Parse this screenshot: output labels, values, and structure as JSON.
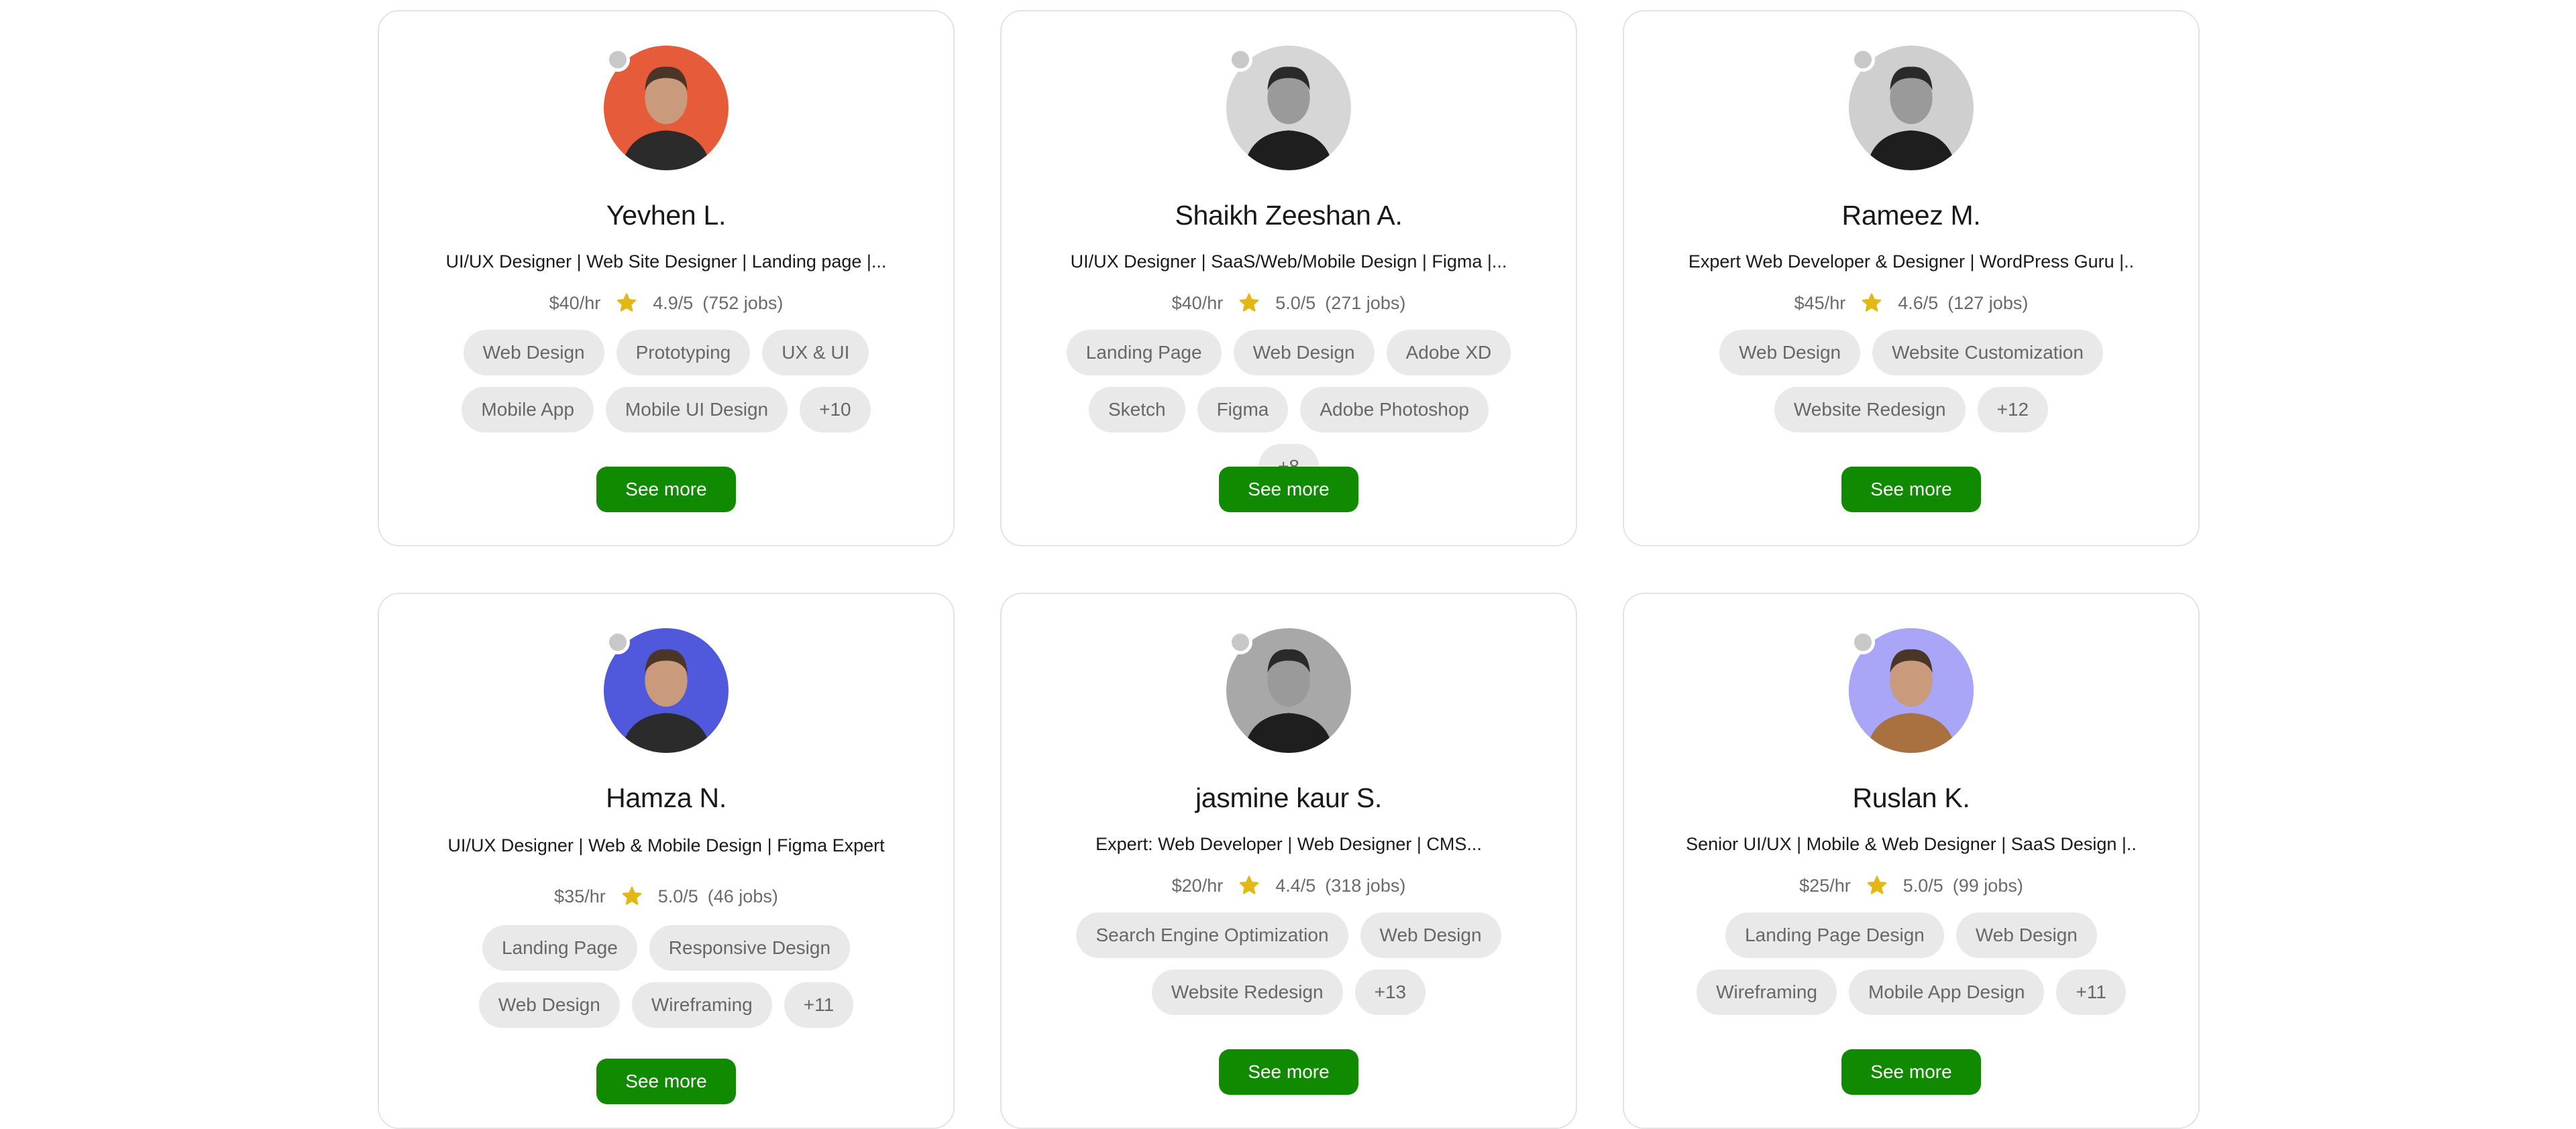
{
  "colors": {
    "accent_green": "#108a00",
    "chip_bg": "#e9e9e9",
    "star": "#e3b814",
    "status_offline": "#c8c8c8"
  },
  "cards": [
    {
      "name": "Yevhen L.",
      "headline": "UI/UX Designer | Web Site Designer | Landing page |...",
      "rate": "$40/hr",
      "rating": "4.9/5",
      "jobs": "(752 jobs)",
      "avatar_icon": "profile-photo",
      "avatar_bg": "#e65c3b",
      "skills": [
        "Web Design",
        "Prototyping",
        "UX & UI",
        "Mobile App",
        "Mobile UI Design",
        "+10"
      ],
      "button_label": "See more"
    },
    {
      "name": "Shaikh Zeeshan A.",
      "headline": "UI/UX Designer | SaaS/Web/Mobile Design | Figma |...",
      "rate": "$40/hr",
      "rating": "5.0/5",
      "jobs": "(271 jobs)",
      "avatar_icon": "profile-photo",
      "avatar_bg": "#d6d6d6",
      "skills": [
        "Landing Page",
        "Web Design",
        "Adobe XD",
        "Sketch",
        "Figma",
        "Adobe Photoshop",
        "+8"
      ],
      "button_label": "See more"
    },
    {
      "name": "Rameez M.",
      "headline": "Expert Web Developer & Designer | WordPress Guru |..",
      "rate": "$45/hr",
      "rating": "4.6/5",
      "jobs": "(127 jobs)",
      "avatar_icon": "profile-photo",
      "avatar_bg": "#cfcfcf",
      "skills": [
        "Web Design",
        "Website Customization",
        "Website Redesign",
        "+12"
      ],
      "button_label": "See more"
    },
    {
      "name": "Hamza N.",
      "headline": "UI/UX Designer | Web & Mobile Design | Figma Expert",
      "rate": "$35/hr",
      "rating": "5.0/5",
      "jobs": "(46 jobs)",
      "avatar_icon": "profile-photo",
      "avatar_bg": "#5058dc",
      "skills": [
        "Landing Page",
        "Responsive Design",
        "Web Design",
        "Wireframing",
        "+11"
      ],
      "button_label": "See more"
    },
    {
      "name": "jasmine kaur S.",
      "headline": "Expert: Web Developer | Web Designer | CMS...",
      "rate": "$20/hr",
      "rating": "4.4/5",
      "jobs": "(318 jobs)",
      "avatar_icon": "profile-photo",
      "avatar_bg": "#a8a8a8",
      "skills": [
        "Search Engine Optimization",
        "Web Design",
        "Website Redesign",
        "+13"
      ],
      "button_label": "See more"
    },
    {
      "name": "Ruslan K.",
      "headline": "Senior UI/UX | Mobile & Web Designer | SaaS Design |..",
      "rate": "$25/hr",
      "rating": "5.0/5",
      "jobs": "(99 jobs)",
      "avatar_icon": "profile-photo",
      "avatar_bg": "#aaa6f7",
      "skills": [
        "Landing Page Design",
        "Web Design",
        "Wireframing",
        "Mobile App Design",
        "+11"
      ],
      "button_label": "See more"
    }
  ]
}
